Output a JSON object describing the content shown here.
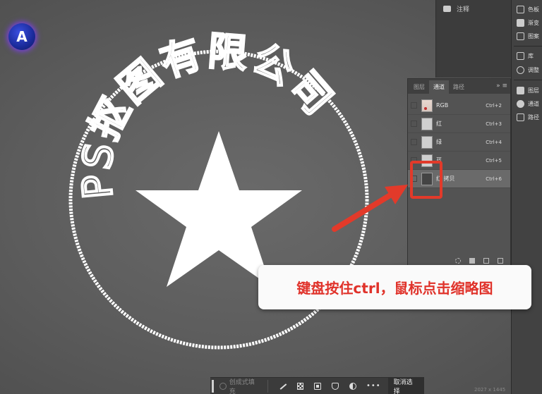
{
  "stamp": {
    "ring_text": "PS抠图有限公司"
  },
  "logo": {
    "glyph": "A"
  },
  "right_panel": {
    "comment_label": "注释"
  },
  "far_panel": {
    "items": [
      {
        "label": "色板",
        "icon": "grid-icon"
      },
      {
        "label": "渐变",
        "icon": "gradient-icon"
      },
      {
        "label": "图案",
        "icon": "pattern-icon"
      },
      {
        "label": "库",
        "icon": "library-icon"
      },
      {
        "label": "调整",
        "icon": "adjust-icon"
      },
      {
        "label": "图层",
        "icon": "layers-icon"
      },
      {
        "label": "通道",
        "icon": "channels-icon"
      },
      {
        "label": "路径",
        "icon": "paths-icon"
      }
    ]
  },
  "channels_panel": {
    "tabs": [
      "图层",
      "通道",
      "路径"
    ],
    "active_tab": "通道",
    "channels": [
      {
        "name": "RGB",
        "shortcut": "Ctrl+2"
      },
      {
        "name": "红",
        "shortcut": "Ctrl+3"
      },
      {
        "name": "绿",
        "shortcut": "Ctrl+4"
      },
      {
        "name": "蓝",
        "shortcut": "Ctrl+5"
      },
      {
        "name": "红 拷贝",
        "shortcut": "Ctrl+6"
      }
    ],
    "selected_channel": "红 拷贝"
  },
  "callout": {
    "text": "键盘按住ctrl，鼠标点击缩略图",
    "color": "#e0322a"
  },
  "bottom_bar": {
    "generative_fill": "创成式填充",
    "deselect": "取消选择"
  },
  "status": {
    "coords": "2027 x 1445"
  },
  "colors": {
    "highlight": "#e23a2a",
    "canvas": "#5c5c5c",
    "panel": "#535353"
  }
}
